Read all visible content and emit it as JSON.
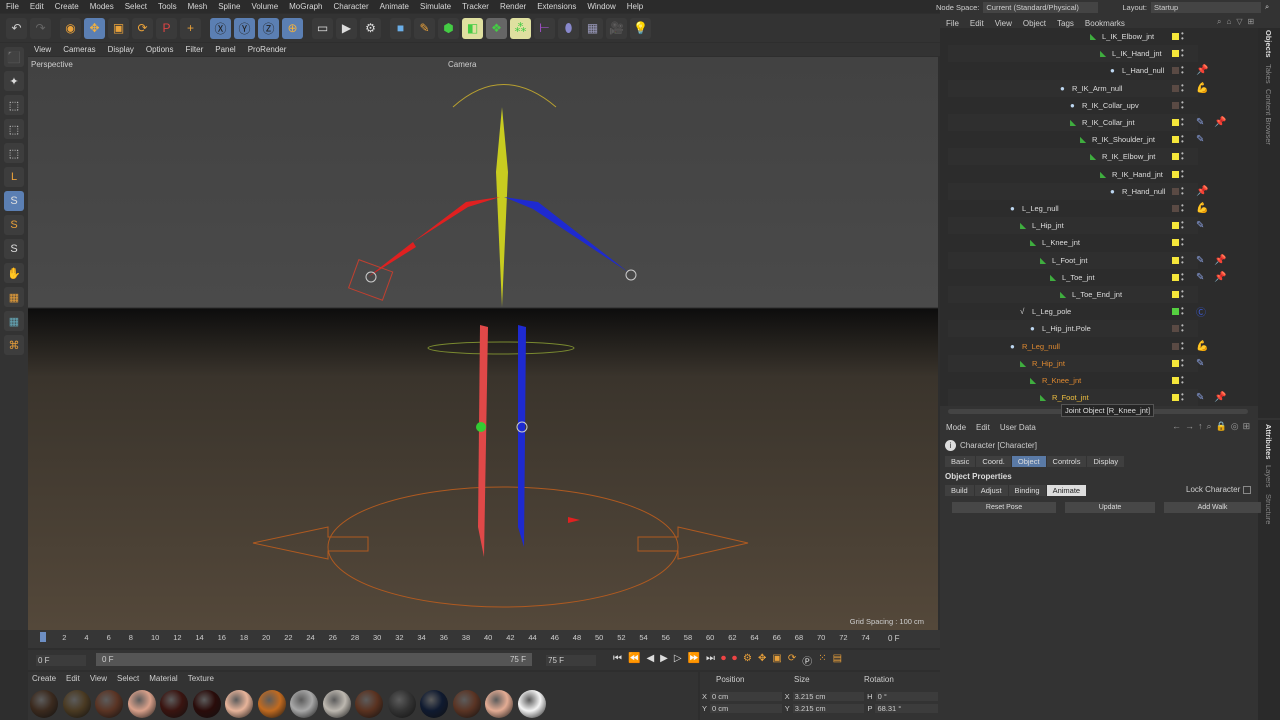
{
  "menubar": [
    "File",
    "Edit",
    "Create",
    "Modes",
    "Select",
    "Tools",
    "Mesh",
    "Spline",
    "Volume",
    "MoGraph",
    "Character",
    "Animate",
    "Simulate",
    "Tracker",
    "Render",
    "Extensions",
    "Window",
    "Help"
  ],
  "viewport_menu": [
    "View",
    "Cameras",
    "Display",
    "Options",
    "Filter",
    "Panel",
    "ProRender"
  ],
  "viewport": {
    "label": "Perspective",
    "camera": "Camera",
    "grid_spacing": "Grid Spacing : 100 cm"
  },
  "topbar": {
    "node_space_label": "Node Space:",
    "node_space_value": "Current (Standard/Physical)",
    "layout_label": "Layout:",
    "layout_value": "Startup"
  },
  "om_menu": [
    "File",
    "Edit",
    "View",
    "Object",
    "Tags",
    "Bookmarks"
  ],
  "side_tabs": {
    "objects": "Objects",
    "takes": "Takes",
    "content": "Content Browser",
    "attributes": "Attributes",
    "layers": "Layers",
    "structure": "Structure"
  },
  "tree": [
    {
      "name": "L_IK_Elbow_jnt",
      "level": 8,
      "type": "joint",
      "swatch": "#f5e63a",
      "tags": ""
    },
    {
      "name": "L_IK_Hand_jnt",
      "level": 9,
      "type": "joint",
      "swatch": "#f5e63a",
      "tags": ""
    },
    {
      "name": "L_Hand_null",
      "level": 10,
      "type": "null",
      "swatch": "#5a4a44",
      "tags": "pin"
    },
    {
      "name": "R_IK_Arm_null",
      "level": 5,
      "type": "null",
      "swatch": "#5a4a44",
      "tags": "arm-red"
    },
    {
      "name": "R_IK_Collar_upv",
      "level": 6,
      "type": "null",
      "swatch": "#5a4a44",
      "tags": ""
    },
    {
      "name": "R_IK_Collar_jnt",
      "level": 6,
      "type": "joint",
      "swatch": "#f5e63a",
      "tags": "weight+pin"
    },
    {
      "name": "R_IK_Shoulder_jnt",
      "level": 7,
      "type": "joint",
      "swatch": "#f5e63a",
      "tags": "weight"
    },
    {
      "name": "R_IK_Elbow_jnt",
      "level": 8,
      "type": "joint",
      "swatch": "#f5e63a",
      "tags": ""
    },
    {
      "name": "R_IK_Hand_jnt",
      "level": 9,
      "type": "joint",
      "swatch": "#f5e63a",
      "tags": ""
    },
    {
      "name": "R_Hand_null",
      "level": 10,
      "type": "null",
      "swatch": "#5a4a44",
      "tags": "pin"
    },
    {
      "name": "L_Leg_null",
      "level": 0,
      "type": "null",
      "swatch": "#5a4a44",
      "tags": "arm-blue"
    },
    {
      "name": "L_Hip_jnt",
      "level": 1,
      "type": "joint",
      "swatch": "#f5e63a",
      "tags": "weight"
    },
    {
      "name": "L_Knee_jnt",
      "level": 2,
      "type": "joint",
      "swatch": "#f5e63a",
      "tags": ""
    },
    {
      "name": "L_Foot_jnt",
      "level": 3,
      "type": "joint",
      "swatch": "#f5e63a",
      "tags": "weight+pin"
    },
    {
      "name": "L_Toe_jnt",
      "level": 4,
      "type": "joint",
      "swatch": "#f5e63a",
      "tags": "weight+pin"
    },
    {
      "name": "L_Toe_End_jnt",
      "level": 5,
      "type": "joint",
      "swatch": "#f5e63a",
      "tags": ""
    },
    {
      "name": "L_Leg_pole",
      "level": 1,
      "type": "spline",
      "swatch": "#55d040",
      "tags": "constraint"
    },
    {
      "name": "L_Hip_jnt.Pole",
      "level": 2,
      "type": "null",
      "swatch": "#5a4a44",
      "tags": ""
    },
    {
      "name": "R_Leg_null",
      "level": 0,
      "type": "null",
      "swatch": "#5a4a44",
      "tags": "arm-red",
      "selected": true
    },
    {
      "name": "R_Hip_jnt",
      "level": 1,
      "type": "joint",
      "swatch": "#f5e63a",
      "tags": "weight",
      "selected": true
    },
    {
      "name": "R_Knee_jnt",
      "level": 2,
      "type": "joint",
      "swatch": "#f5e63a",
      "tags": "",
      "selected": true
    },
    {
      "name": "R_Foot_jnt",
      "level": 3,
      "type": "joint",
      "swatch": "#f5e63a",
      "tags": "weight+pin",
      "selected": true
    }
  ],
  "tooltip": "Joint Object [R_Knee_jnt]",
  "attributes": {
    "menu": [
      "Mode",
      "Edit",
      "User Data"
    ],
    "object_title": "Character [Character]",
    "tabs": [
      "Basic",
      "Coord.",
      "Object",
      "Controls",
      "Display"
    ],
    "active_tab": "Object",
    "section": "Object Properties",
    "subtabs": [
      "Build",
      "Adjust",
      "Binding",
      "Animate"
    ],
    "active_subtab": "Animate",
    "lock_label": "Lock Character",
    "buttons": [
      "Reset Pose",
      "Update",
      "Add Walk"
    ]
  },
  "timeline": {
    "ticks": [
      "0",
      "2",
      "4",
      "6",
      "8",
      "10",
      "12",
      "14",
      "16",
      "18",
      "20",
      "22",
      "24",
      "26",
      "28",
      "30",
      "32",
      "34",
      "36",
      "38",
      "40",
      "42",
      "44",
      "46",
      "48",
      "50",
      "52",
      "54",
      "56",
      "58",
      "60",
      "62",
      "64",
      "66",
      "68",
      "70",
      "72",
      "74"
    ],
    "current_frame": "0 F",
    "start": "0 F",
    "range_start": "0 F",
    "range_end": "75 F",
    "end": "75 F"
  },
  "material_menu": [
    "Create",
    "Edit",
    "View",
    "Select",
    "Material",
    "Texture"
  ],
  "materials": [
    "#3b2a1e",
    "#4a3a22",
    "#5a3424",
    "#d9a08a",
    "#3a1410",
    "#2a0c0a",
    "#e8b49a",
    "#c06a20",
    "#a8a8a8",
    "#bdb8b0",
    "#5a3220",
    "#333333",
    "#0f1a30",
    "#5a3424",
    "#e4ac94",
    "#f4f4f4"
  ],
  "coords": {
    "headers": [
      "Position",
      "Size",
      "Rotation"
    ],
    "rows": [
      {
        "axis": "X",
        "pos": "0 cm",
        "size_axis": "X",
        "size": "3.215 cm",
        "rot_axis": "H",
        "rot": "0 °"
      },
      {
        "axis": "Y",
        "pos": "0 cm",
        "size_axis": "Y",
        "size": "3.215 cm",
        "rot_axis": "P",
        "rot": "68.31 °"
      }
    ]
  }
}
